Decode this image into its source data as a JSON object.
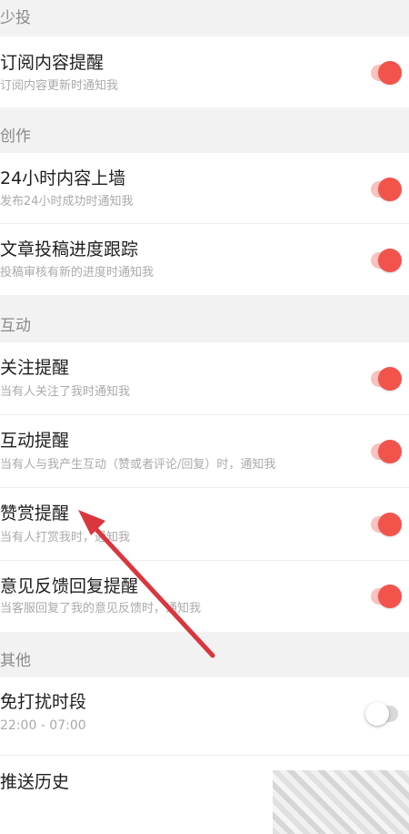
{
  "sections": [
    {
      "label": "少投"
    },
    {
      "label": "创作"
    },
    {
      "label": "互动"
    },
    {
      "label": "其他"
    }
  ],
  "rows": [
    {
      "title": "订阅内容提醒",
      "subtitle": "订阅内容更新时通知我",
      "toggle": "on"
    },
    {
      "title": "24小时内容上墙",
      "subtitle": "发布24小时成功时通知我",
      "toggle": "on"
    },
    {
      "title": "文章投稿进度跟踪",
      "subtitle": "投稿审核有新的进度时通知我",
      "toggle": "on"
    },
    {
      "title": "关注提醒",
      "subtitle": "当有人关注了我时通知我",
      "toggle": "on"
    },
    {
      "title": "互动提醒",
      "subtitle": "当有人与我产生互动（赞或者评论/回复）时，通知我",
      "toggle": "on"
    },
    {
      "title": "赞赏提醒",
      "subtitle": "当有人打赏我时，通知我",
      "toggle": "on"
    },
    {
      "title": "意见反馈回复提醒",
      "subtitle": "当客服回复了我的意见反馈时，通知我",
      "toggle": "on"
    },
    {
      "title": "免打扰时段",
      "subtitle": "22:00 - 07:00",
      "toggle": "off"
    },
    {
      "title": "推送历史",
      "subtitle": "",
      "toggle": "none"
    }
  ],
  "colors": {
    "accent": "#f2534b",
    "arrow": "#d9363e"
  }
}
